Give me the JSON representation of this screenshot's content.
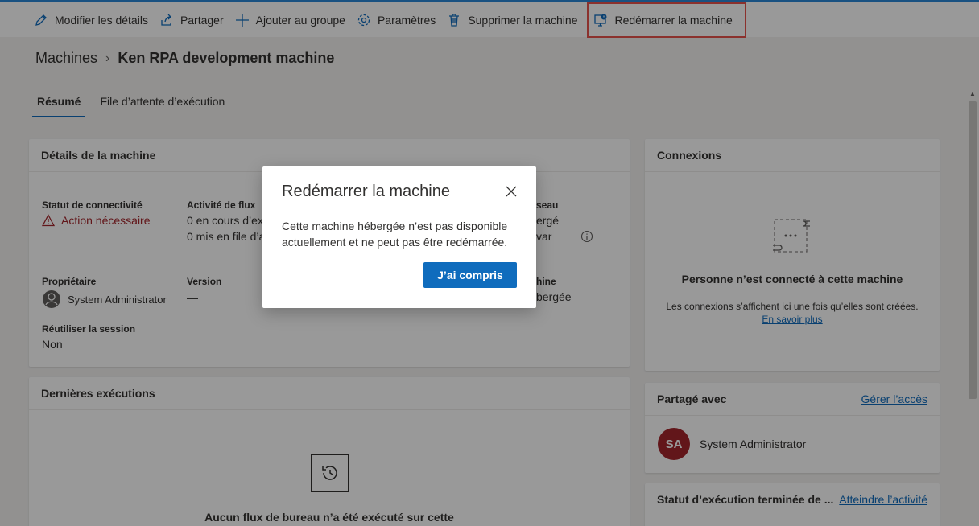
{
  "toolbar": {
    "items": [
      {
        "label": "Modifier les détails",
        "icon": "pencil-icon"
      },
      {
        "label": "Partager",
        "icon": "share-icon"
      },
      {
        "label": "Ajouter au groupe",
        "icon": "plus-icon"
      },
      {
        "label": "Paramètres",
        "icon": "gear-icon"
      },
      {
        "label": "Supprimer la machine",
        "icon": "trash-icon"
      },
      {
        "label": "Redémarrer la machine",
        "icon": "restart-machine-icon"
      }
    ]
  },
  "breadcrumb": {
    "parent": "Machines",
    "current": "Ken RPA development machine"
  },
  "tabs": [
    {
      "label": "Résumé",
      "active": true
    },
    {
      "label": "File d’attente d’exécution",
      "active": false
    }
  ],
  "details": {
    "title": "Détails de la machine",
    "connectivity_label": "Statut de connectivité",
    "connectivity_value": "Action nécessaire",
    "flow_label": "Activité de flux",
    "flow_running": "0 en cours d’ex",
    "flow_queued": "0 mis en file d’a",
    "col3_label_fragment": "seau",
    "col3_val1_fragment": "ergé",
    "col3_val2_fragment": "var",
    "owner_label": "Propriétaire",
    "owner_value": "System Administrator",
    "version_label": "Version",
    "version_value": "—",
    "col3b_label_fragment": "hine",
    "col3b_value_fragment": "bergée",
    "reuse_label": "Réutiliser la session",
    "reuse_value": "Non"
  },
  "executions": {
    "title": "Dernières exécutions",
    "empty_text": "Aucun flux de bureau n’a été exécuté sur cette"
  },
  "connexions": {
    "title": "Connexions",
    "empty_title": "Personne n’est connecté à cette machine",
    "empty_desc": "Les connexions s’affichent ici une fois qu’elles sont créées.",
    "learn_more": "En savoir plus"
  },
  "shared": {
    "title": "Partagé avec",
    "manage_link": "Gérer l’accès",
    "user_initials": "SA",
    "user_name": "System Administrator",
    "avatar_color": "#a4262c"
  },
  "status": {
    "title": "Statut d’exécution terminée de ...",
    "link": "Atteindre l’activité"
  },
  "dialog": {
    "title": "Redémarrer la machine",
    "body": "Cette machine hébergée n’est pas disponible actuellement et ne peut pas être redémarrée.",
    "button": "J’ai compris"
  },
  "colors": {
    "accent": "#0f6cbd",
    "warning": "#a4262c",
    "highlight": "#e8524b"
  }
}
